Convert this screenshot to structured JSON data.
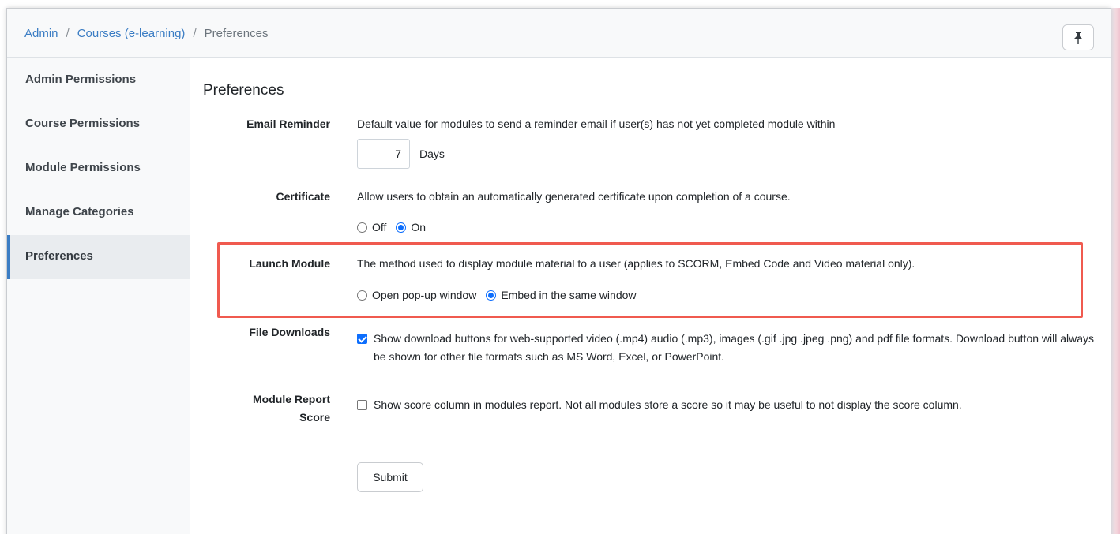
{
  "breadcrumb": {
    "admin": "Admin",
    "courses": "Courses (e-learning)",
    "current": "Preferences",
    "separator": "/"
  },
  "sidebar": {
    "items": [
      {
        "label": "Admin Permissions"
      },
      {
        "label": "Course Permissions"
      },
      {
        "label": "Module Permissions"
      },
      {
        "label": "Manage Categories"
      },
      {
        "label": "Preferences",
        "active": true
      }
    ]
  },
  "main": {
    "title": "Preferences",
    "email_reminder": {
      "label": "Email Reminder",
      "description": "Default value for modules to send a reminder email if user(s) has not yet completed module within",
      "value": "7",
      "unit": "Days"
    },
    "certificate": {
      "label": "Certificate",
      "description": "Allow users to obtain an automatically generated certificate upon completion of a course.",
      "options": [
        "Off",
        "On"
      ],
      "selected": "On"
    },
    "launch_module": {
      "label": "Launch Module",
      "description": "The method used to display module material to a user (applies to SCORM, Embed Code and Video material only).",
      "options": [
        "Open pop-up window",
        "Embed in the same window"
      ],
      "selected": "Embed in the same window"
    },
    "file_downloads": {
      "label": "File Downloads",
      "checked": true,
      "text": "Show download buttons for web-supported video (.mp4) audio (.mp3), images (.gif .jpg .jpeg .png) and pdf file formats. Download button will always be shown for other file formats such as MS Word, Excel, or PowerPoint."
    },
    "module_report_score": {
      "label_line1": "Module Report",
      "label_line2": "Score",
      "checked": false,
      "text": "Show score column in modules report. Not all modules store a score so it may be useful to not display the score column."
    },
    "submit_label": "Submit"
  },
  "colors": {
    "link": "#3b7dc4",
    "accent": "#0d6efd",
    "highlight": "#f05a4f"
  },
  "icons": {
    "pin": "pin-icon"
  }
}
